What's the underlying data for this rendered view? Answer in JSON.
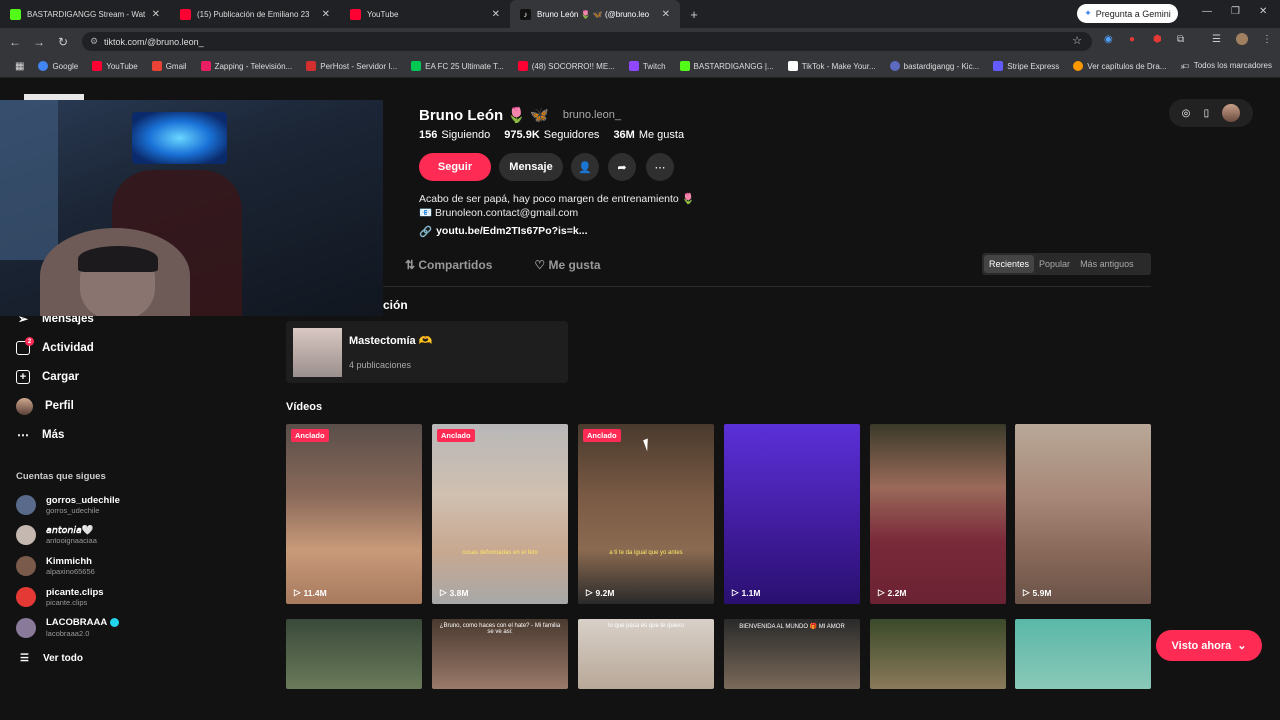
{
  "browser": {
    "tabs": [
      {
        "title": "BASTARDIGANGG Stream - Wat",
        "color": "#53fc18"
      },
      {
        "title": "(15) Publicación de Emiliano 23",
        "color": "#ff0033"
      },
      {
        "title": "YouTube",
        "color": "#ff0033"
      },
      {
        "title": "Bruno León 🌷 🦋 (@bruno.leo",
        "color": "#ffffff"
      }
    ],
    "gemini_label": "Pregunta a Gemini",
    "url": "tiktok.com/@bruno.leon_",
    "bookmarks": [
      {
        "label": "Google",
        "color": "#4285f4"
      },
      {
        "label": "YouTube",
        "color": "#ff0033"
      },
      {
        "label": "Gmail",
        "color": "#ea4335"
      },
      {
        "label": "Zapping - Televisión...",
        "color": "#e91e63"
      },
      {
        "label": "PerHost - Servidor I...",
        "color": "#d32f2f"
      },
      {
        "label": "EA FC 25 Ultimate T...",
        "color": "#00c853"
      },
      {
        "label": "(48) SOCORRO!! ME...",
        "color": "#ff0033"
      },
      {
        "label": "Twitch",
        "color": "#9146ff"
      },
      {
        "label": "BASTARDIGANGG |...",
        "color": "#53fc18"
      },
      {
        "label": "TikTok - Make Your...",
        "color": "#ffffff"
      },
      {
        "label": "bastardigangg - Kic...",
        "color": "#5c6bc0"
      },
      {
        "label": "Stripe Express",
        "color": "#635bff"
      },
      {
        "label": "Ver capítulos de Dra...",
        "color": "#ff9800"
      }
    ],
    "more_bookmarks": "»",
    "all_bookmarks": "Todos los marcadores"
  },
  "sidebar": {
    "items": [
      {
        "label": "Mensajes",
        "icon": "send-icon"
      },
      {
        "label": "Actividad",
        "icon": "activity-icon",
        "badge": "2"
      },
      {
        "label": "Cargar",
        "icon": "upload-icon"
      },
      {
        "label": "Perfil",
        "icon": "profile-avatar"
      },
      {
        "label": "Más",
        "icon": "more-icon"
      }
    ],
    "following_title": "Cuentas que sigues",
    "following": [
      {
        "name": "gorros_udechile",
        "handle": "gorros_udechile",
        "color": "#5a6a8a"
      },
      {
        "name": "𝘢𝘯𝘵𝘰𝘯𝘪𝘢🤍",
        "handle": "antooignaaciaa",
        "color": "#c4b8b0"
      },
      {
        "name": "Kimmichh",
        "handle": "alpaxino65656",
        "color": "#7a5a4a"
      },
      {
        "name": "picante.clips",
        "handle": "picante.clips",
        "color": "#e53935"
      },
      {
        "name": "LACOBRAAA",
        "handle": "lacobraaa2.0",
        "color": "#8a7a9a",
        "verified": true
      }
    ],
    "see_all": "Ver todo"
  },
  "profile": {
    "name": "Bruno León 🌷 🦋",
    "handle": "bruno.leon_",
    "following_count": "156",
    "following_label": "Siguiendo",
    "followers_count": "975.9K",
    "followers_label": "Seguidores",
    "likes_count": "36M",
    "likes_label": "Me gusta",
    "follow_btn": "Seguir",
    "message_btn": "Mensaje",
    "bio_line1": "Acabo de ser papá, hay poco margen de entrenamiento 🌷",
    "bio_line2": "📧 Brunoleon.contact@gmail.com",
    "bio_link": "youtu.be/Edm2TIs67Po?is=k..."
  },
  "content_tabs": {
    "shared": "Compartidos",
    "liked": "Me gusta"
  },
  "sort": {
    "options": [
      "Recientes",
      "Popular",
      "Más antiguos"
    ]
  },
  "collection": {
    "section_label": "ción",
    "title": "Mastectomía 🫶",
    "count": "4 publicaciones"
  },
  "videos_title": "Vídeos",
  "pinned_label": "Anclado",
  "videos": [
    {
      "views": "11.4M",
      "pinned": true,
      "bg": "linear-gradient(180deg,#5a4e4a 0%,#8a6a5a 40%,#c99a7a 70%,#a87a5e 100%)",
      "caption": ""
    },
    {
      "views": "3.8M",
      "pinned": true,
      "bg": "linear-gradient(180deg,#b8b8b8 0%,#d0c0b0 40%,#c8a890 70%,#a8a8a8 100%)",
      "caption": "cosas deformadas en el feto"
    },
    {
      "views": "9.2M",
      "pinned": true,
      "bg": "linear-gradient(180deg,#4a3a2e 0%,#7a5a44 40%,#8a6a50 70%,#2a2a2a 100%)",
      "caption": "a ti te da igual que yo antes"
    },
    {
      "views": "1.1M",
      "pinned": false,
      "bg": "linear-gradient(180deg,#5a30d8 0%,#4a22b0 40%,#3a1890 70%,#2a1070 100%)",
      "caption": ""
    },
    {
      "views": "2.2M",
      "pinned": false,
      "bg": "linear-gradient(180deg,#3a3a2a 0%,#9a6a5a 35%,#7a2a3a 65%,#6a2232 100%)",
      "caption": ""
    },
    {
      "views": "5.9M",
      "pinned": false,
      "bg": "linear-gradient(180deg,#b8a898 0%,#a88878 40%,#8a6a5a 70%,#6a5248 100%)",
      "caption": ""
    }
  ],
  "videos_row2": [
    {
      "bg": "linear-gradient(180deg,#3a4a3a,#6a7a5a)",
      "caption": ""
    },
    {
      "bg": "linear-gradient(180deg,#4a3a30,#9a7a6a)",
      "caption": "¿Bruno, como haces con el hate? - Mi familia se ve asi:"
    },
    {
      "bg": "linear-gradient(180deg,#d8d0c8,#b8a898)",
      "caption": "lo que pasa es que te quiero"
    },
    {
      "bg": "linear-gradient(180deg,#2a2a2a,#7a6a5a)",
      "caption": "BIENVENIDA AL MUNDO 🎁 MI AMOR"
    },
    {
      "bg": "linear-gradient(180deg,#3a4a2a,#8a7a5a)",
      "caption": ""
    },
    {
      "bg": "linear-gradient(180deg,#5ab8a8,#8ac8b8)",
      "caption": ""
    }
  ],
  "visto_ahora": "Visto ahora",
  "colors": {
    "accent": "#fe2c55",
    "background": "#121212"
  }
}
